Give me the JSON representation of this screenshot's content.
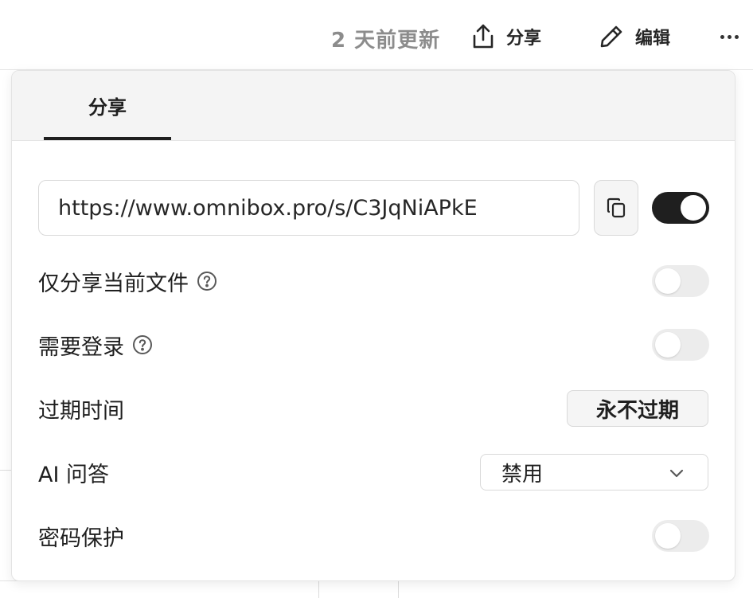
{
  "header": {
    "updated": "2 天前更新",
    "share_label": "分享",
    "edit_label": "编辑"
  },
  "popover": {
    "tab_label": "分享",
    "share_url": "https://www.omnibox.pro/s/C3JqNiAPkE",
    "share_enabled": true,
    "options": {
      "current_file_only": {
        "label": "仅分享当前文件",
        "enabled": false
      },
      "require_login": {
        "label": "需要登录",
        "enabled": false
      },
      "expiry": {
        "label": "过期时间",
        "value": "永不过期"
      },
      "ai_qa": {
        "label": "AI 问答",
        "value": "禁用"
      },
      "password": {
        "label": "密码保护",
        "enabled": false
      }
    }
  },
  "colors": {
    "toggle_on": "#1f1f1f",
    "toggle_off": "#ececec",
    "muted_text": "#8c8c8c"
  }
}
